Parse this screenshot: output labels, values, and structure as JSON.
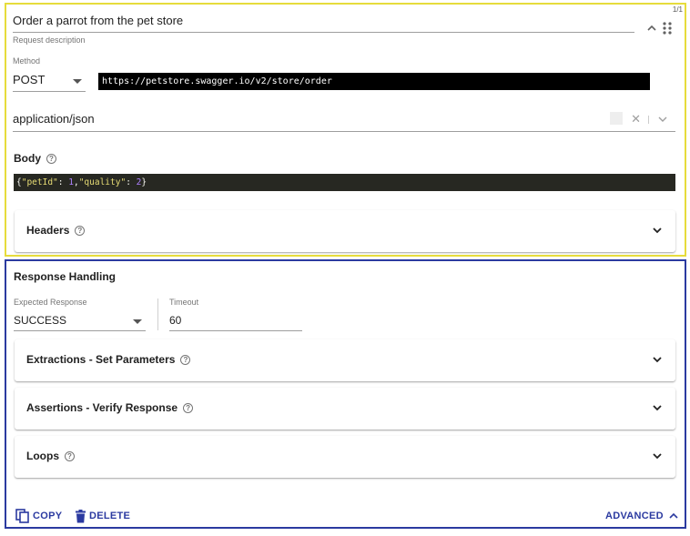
{
  "request": {
    "counter": "1/1",
    "description_value": "Order a parrot from the pet store",
    "description_label": "Request description",
    "method_label": "Method",
    "method_value": "POST",
    "url": "https://petstore.swagger.io/v2/store/order",
    "content_type": "application/json",
    "clear_symbol": "✕",
    "body_title": "Body",
    "body_code": {
      "open": "{",
      "key1": "\"petId\"",
      "sep1": ": ",
      "val1": "1",
      "comma": ",",
      "key2": "\"quality\"",
      "sep2": ": ",
      "val2": "2",
      "close": "}"
    },
    "headers_title": "Headers"
  },
  "response": {
    "title": "Response Handling",
    "expected_label": "Expected Response",
    "expected_value": "SUCCESS",
    "timeout_label": "Timeout",
    "timeout_value": "60",
    "extractions_title": "Extractions - Set Parameters",
    "assertions_title": "Assertions - Verify Response",
    "loops_title": "Loops"
  },
  "footer": {
    "copy_label": "COPY",
    "delete_label": "DELETE",
    "advanced_label": "ADVANCED"
  },
  "help_glyph": "?",
  "colors": {
    "request_border": "#e6dc3c",
    "response_border": "#2b3aa0",
    "accent": "#2b3aa0",
    "code_bg": "#272822"
  },
  "icons": {
    "collapse": "chevron-up-icon",
    "drag": "drag-handle-icon",
    "expand": "chevron-down-icon",
    "help": "help-circle-icon",
    "copy": "copy-icon",
    "delete": "trash-icon"
  }
}
